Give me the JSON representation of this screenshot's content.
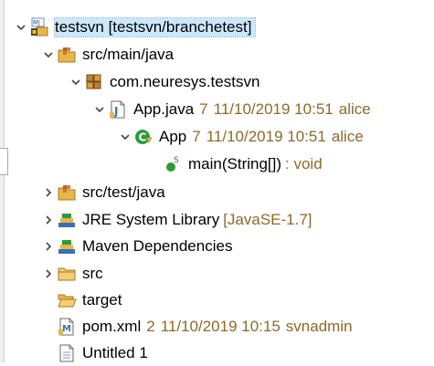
{
  "tree": {
    "project": {
      "label": "testsvn [testsvn/branchetest]",
      "icon": "maven-project-icon"
    },
    "src_main": {
      "label": "src/main/java",
      "icon": "source-folder-icon"
    },
    "package": {
      "label": "com.neuresys.testsvn",
      "icon": "package-icon"
    },
    "app_java": {
      "label": "App.java",
      "revision": "7",
      "date": "11/10/2019 10:51",
      "author": "alice",
      "icon": "java-file-icon"
    },
    "app_class": {
      "label": "App",
      "revision": "7",
      "date": "11/10/2019 10:51",
      "author": "alice",
      "icon": "class-icon"
    },
    "main_method": {
      "label": "main(String[])",
      "signature": ": void",
      "icon": "static-method-icon"
    },
    "src_test": {
      "label": "src/test/java",
      "icon": "source-folder-icon"
    },
    "jre": {
      "label": "JRE System Library",
      "version": "[JavaSE-1.7]",
      "icon": "library-icon"
    },
    "maven_deps": {
      "label": "Maven Dependencies",
      "icon": "library-icon"
    },
    "src": {
      "label": "src",
      "icon": "folder-icon"
    },
    "target": {
      "label": "target",
      "icon": "folder-open-icon"
    },
    "pom": {
      "label": "pom.xml",
      "revision": "2",
      "date": "11/10/2019 10:15",
      "author": "svnadmin",
      "icon": "maven-file-icon"
    },
    "untitled": {
      "label": "Untitled 1",
      "icon": "text-file-icon"
    }
  },
  "colors": {
    "selection": "#cce8ff",
    "decoration": "#8a6a2a",
    "folder": "#e8b64a",
    "class_green": "#2f9a3a"
  }
}
